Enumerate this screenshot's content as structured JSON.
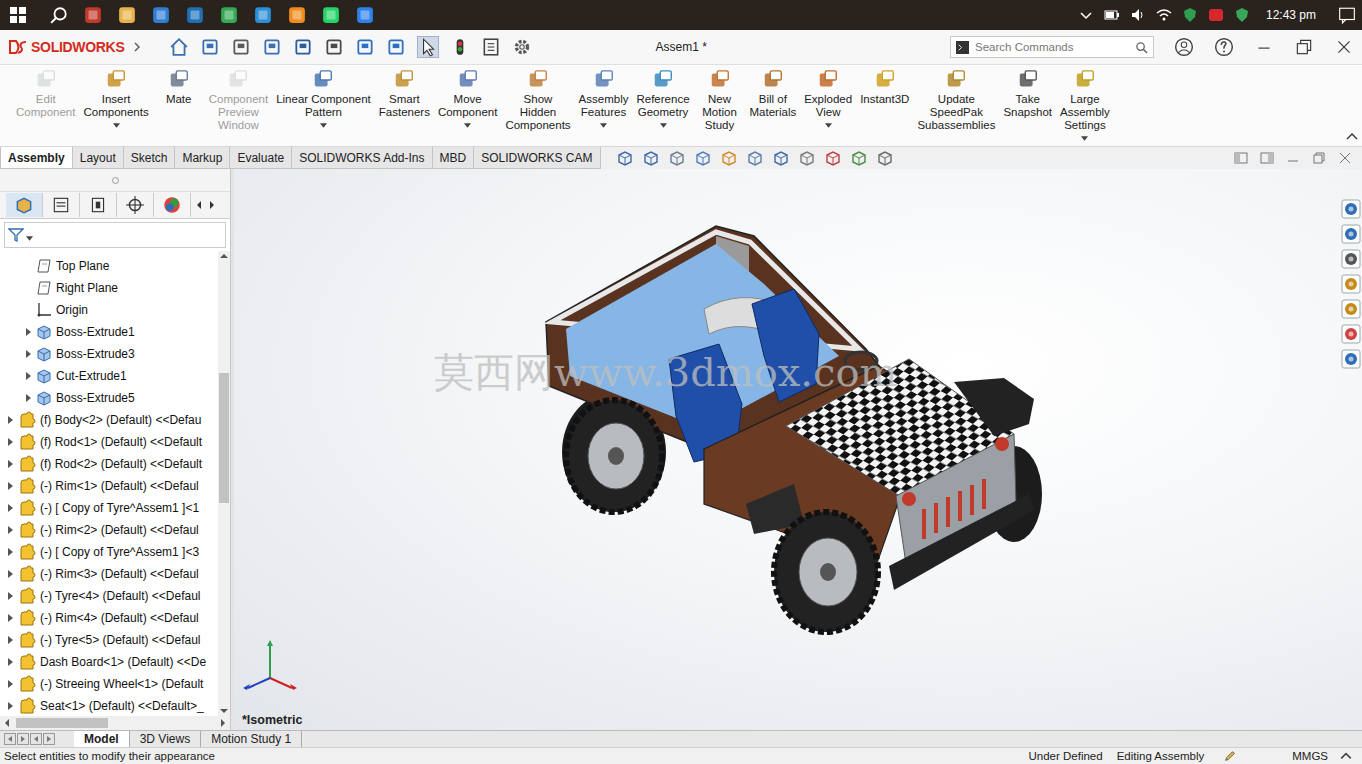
{
  "taskbar": {
    "time": "12:43 pm"
  },
  "app": {
    "brand": "SOLIDWORKS",
    "document_title": "Assem1 *",
    "search_placeholder": "Search Commands"
  },
  "ribbon": [
    {
      "lines": [
        "Edit",
        "Component"
      ],
      "disabled": true,
      "dropdown": false
    },
    {
      "lines": [
        "Insert",
        "Components"
      ],
      "disabled": false,
      "dropdown": true
    },
    {
      "lines": [
        "Mate"
      ],
      "disabled": false,
      "dropdown": false
    },
    {
      "lines": [
        "Component",
        "Preview",
        "Window"
      ],
      "disabled": true,
      "dropdown": false
    },
    {
      "lines": [
        "Linear Component",
        "Pattern"
      ],
      "disabled": false,
      "dropdown": true
    },
    {
      "lines": [
        "Smart",
        "Fasteners"
      ],
      "disabled": false,
      "dropdown": false
    },
    {
      "lines": [
        "Move",
        "Component"
      ],
      "disabled": false,
      "dropdown": true
    },
    {
      "lines": [
        "Show",
        "Hidden",
        "Components"
      ],
      "disabled": false,
      "dropdown": false
    },
    {
      "lines": [
        "Assembly",
        "Features"
      ],
      "disabled": false,
      "dropdown": true
    },
    {
      "lines": [
        "Reference",
        "Geometry"
      ],
      "disabled": false,
      "dropdown": true
    },
    {
      "lines": [
        "New",
        "Motion",
        "Study"
      ],
      "disabled": false,
      "dropdown": false
    },
    {
      "lines": [
        "Bill of",
        "Materials"
      ],
      "disabled": false,
      "dropdown": false
    },
    {
      "lines": [
        "Exploded",
        "View"
      ],
      "disabled": false,
      "dropdown": true
    },
    {
      "lines": [
        "Instant3D"
      ],
      "disabled": false,
      "dropdown": false
    },
    {
      "lines": [
        "Update",
        "SpeedPak",
        "Subassemblies"
      ],
      "disabled": false,
      "dropdown": false
    },
    {
      "lines": [
        "Take",
        "Snapshot"
      ],
      "disabled": false,
      "dropdown": false
    },
    {
      "lines": [
        "Large",
        "Assembly",
        "Settings"
      ],
      "disabled": false,
      "dropdown": true
    }
  ],
  "tabs": [
    {
      "label": "Assembly",
      "selected": true
    },
    {
      "label": "Layout",
      "selected": false
    },
    {
      "label": "Sketch",
      "selected": false
    },
    {
      "label": "Markup",
      "selected": false
    },
    {
      "label": "Evaluate",
      "selected": false
    },
    {
      "label": "SOLIDWORKS Add-Ins",
      "selected": false
    },
    {
      "label": "MBD",
      "selected": false
    },
    {
      "label": "SOLIDWORKS CAM",
      "selected": false
    }
  ],
  "tree": [
    {
      "label": "Top Plane",
      "kind": "plane",
      "expandable": false
    },
    {
      "label": "Right Plane",
      "kind": "plane",
      "expandable": false
    },
    {
      "label": "Origin",
      "kind": "origin",
      "expandable": false
    },
    {
      "label": "Boss-Extrude1",
      "kind": "feature",
      "expandable": true
    },
    {
      "label": "Boss-Extrude3",
      "kind": "feature",
      "expandable": true
    },
    {
      "label": "Cut-Extrude1",
      "kind": "feature",
      "expandable": true
    },
    {
      "label": "Boss-Extrude5",
      "kind": "feature",
      "expandable": true
    },
    {
      "label": "(f) Body<2> (Default) <<Defau",
      "kind": "component",
      "expandable": true
    },
    {
      "label": "(f) Rod<1> (Default) <<Default",
      "kind": "component",
      "expandable": true
    },
    {
      "label": "(f) Rod<2> (Default) <<Default",
      "kind": "component",
      "expandable": true
    },
    {
      "label": "(-) Rim<1> (Default) <<Defaul",
      "kind": "component",
      "expandable": true
    },
    {
      "label": "(-) [ Copy of Tyre^Assem1 ]<1",
      "kind": "component",
      "expandable": true
    },
    {
      "label": "(-) Rim<2> (Default) <<Defaul",
      "kind": "component",
      "expandable": true
    },
    {
      "label": "(-) [ Copy of Tyre^Assem1 ]<3",
      "kind": "component",
      "expandable": true
    },
    {
      "label": "(-) Rim<3> (Default) <<Defaul",
      "kind": "component",
      "expandable": true
    },
    {
      "label": "(-) Tyre<4> (Default) <<Defaul",
      "kind": "component",
      "expandable": true
    },
    {
      "label": "(-) Rim<4> (Default) <<Defaul",
      "kind": "component",
      "expandable": true
    },
    {
      "label": "(-) Tyre<5> (Default) <<Defaul",
      "kind": "component",
      "expandable": true
    },
    {
      "label": "Dash Board<1> (Default) <<De",
      "kind": "component",
      "expandable": true
    },
    {
      "label": "(-) Streeing Wheel<1> (Default",
      "kind": "component",
      "expandable": true
    },
    {
      "label": "Seat<1> (Default) <<Default>_",
      "kind": "component",
      "expandable": true
    }
  ],
  "graphics": {
    "watermark": "莫西网www.3dmox.com",
    "view_label": "*Isometric"
  },
  "bottom_tabs": [
    {
      "label": "Model",
      "selected": true
    },
    {
      "label": "3D Views",
      "selected": false
    },
    {
      "label": "Motion Study 1",
      "selected": false
    }
  ],
  "status_bar": {
    "message": "Select entities to modify their appearance",
    "state": "Under Defined",
    "mode": "Editing Assembly",
    "units": "MMGS"
  }
}
